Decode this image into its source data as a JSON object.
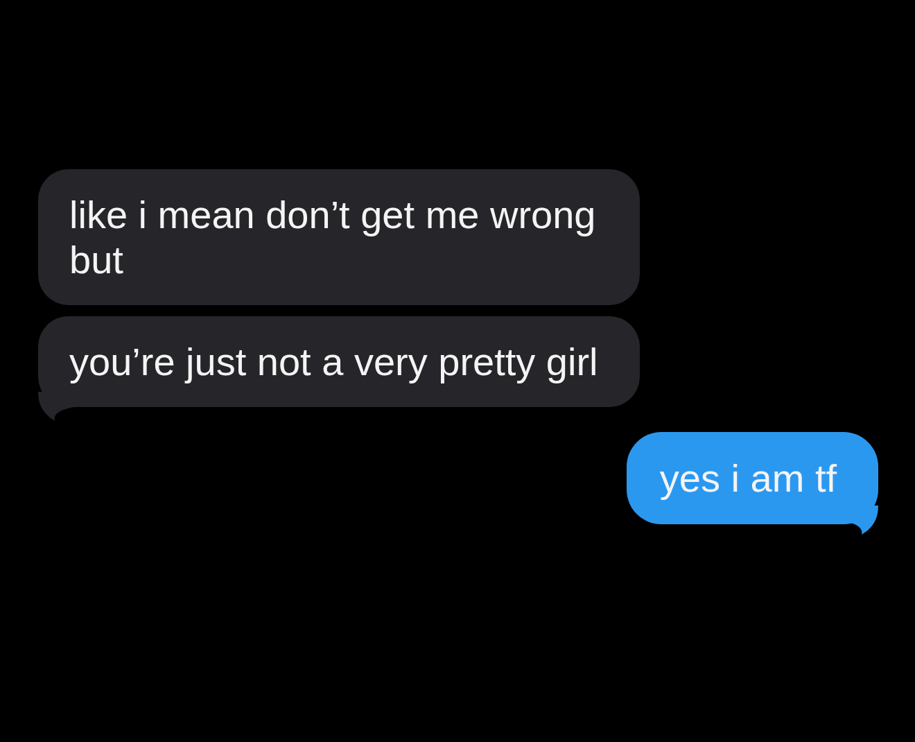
{
  "messages": [
    {
      "kind": "incoming",
      "text": "like i mean don’t get me wrong but",
      "tail": false
    },
    {
      "kind": "incoming",
      "text": "you’re just not a very pretty girl",
      "tail": true
    },
    {
      "kind": "outgoing",
      "text": "yes i am tf",
      "tail": true
    }
  ]
}
